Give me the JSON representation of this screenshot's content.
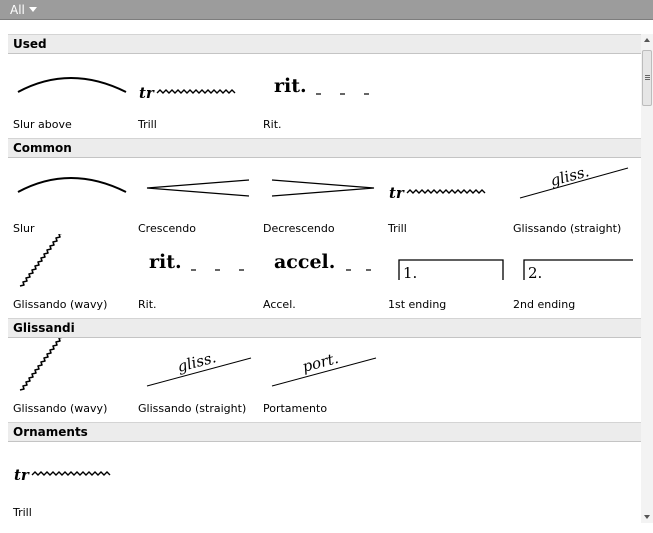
{
  "toolbar": {
    "filter_label": "All"
  },
  "sections": [
    {
      "title": "Used",
      "items": [
        "Slur above",
        "Trill",
        "Rit."
      ]
    },
    {
      "title": "Common",
      "items": [
        "Slur",
        "Crescendo",
        "Decrescendo",
        "Trill",
        "Glissando (straight)",
        "Glissando (wavy)",
        "Rit.",
        "Accel.",
        "1st ending",
        "2nd ending"
      ]
    },
    {
      "title": "Glissandi",
      "items": [
        "Glissando (wavy)",
        "Glissando (straight)",
        "Portamento"
      ]
    },
    {
      "title": "Ornaments",
      "items": [
        "Trill"
      ]
    }
  ],
  "glyphs": {
    "trill": "tr",
    "rit": "rit.",
    "accel": "accel.",
    "gliss": "gliss.",
    "port": "port.",
    "ending1": "1.",
    "ending2": "2."
  },
  "icons": {
    "filter": "triangle-down-icon",
    "scroll_up": "chevron-up-icon",
    "scroll_down": "chevron-down-icon"
  }
}
